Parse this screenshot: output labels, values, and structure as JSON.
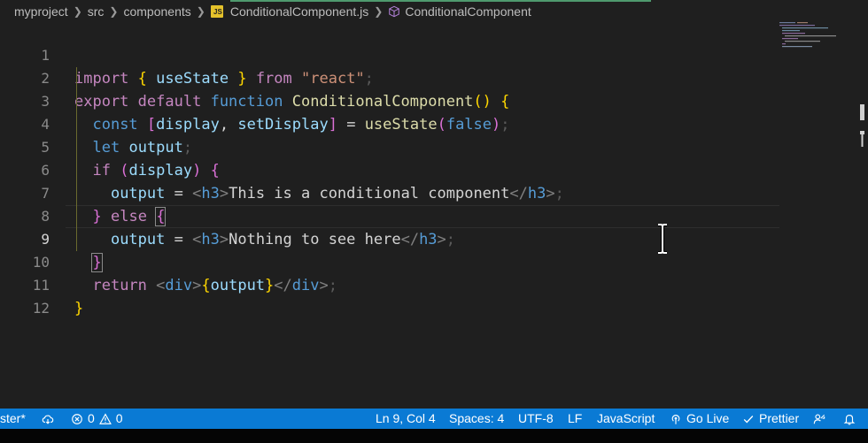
{
  "breadcrumb": {
    "items": [
      "myproject",
      "src",
      "components",
      "ConditionalComponent.js",
      "ConditionalComponent"
    ],
    "file_badge": "JS"
  },
  "editor": {
    "current_line": 9,
    "line_numbers": [
      "1",
      "2",
      "3",
      "4",
      "5",
      "6",
      "7",
      "8",
      "9",
      "10",
      "11",
      "12"
    ],
    "tokens": {
      "l1": [
        "import",
        "{",
        "useState",
        "}",
        "from",
        "\"react\"",
        ";"
      ],
      "l2": [
        "export",
        "default",
        "function",
        "ConditionalComponent",
        "(",
        ")",
        "{"
      ],
      "l3": [
        "const",
        "[",
        "display",
        ",",
        "setDisplay",
        "]",
        "=",
        "useState",
        "(",
        "false",
        ")",
        ";"
      ],
      "l4": [
        "let",
        "output",
        ";"
      ],
      "l5": [
        "if",
        "(",
        "display",
        ")",
        "{"
      ],
      "l6": [
        "output",
        "=",
        "<",
        "h3",
        ">",
        "This is a conditional component",
        "</",
        "h3",
        ">",
        ";"
      ],
      "l7": [
        "}",
        "else",
        "{"
      ],
      "l8": [
        "output",
        "=",
        "<",
        "h3",
        ">",
        "Nothing to see here",
        "</",
        "h3",
        ">",
        ";"
      ],
      "l9": [
        "}"
      ],
      "l10": [
        "return",
        "<",
        "div",
        ">",
        "{",
        "output",
        "}",
        "</",
        "div",
        ">",
        ";"
      ],
      "l11": [
        "}"
      ]
    }
  },
  "statusbar": {
    "branch": "ster*",
    "errors": "0",
    "warnings": "0",
    "position": "Ln 9, Col 4",
    "spaces": "Spaces: 4",
    "encoding": "UTF-8",
    "eol": "LF",
    "language": "JavaScript",
    "go_live": "Go Live",
    "prettier": "Prettier"
  },
  "colors": {
    "statusbar_bg": "#0a7ad4",
    "editor_bg": "#1f1f1f"
  }
}
